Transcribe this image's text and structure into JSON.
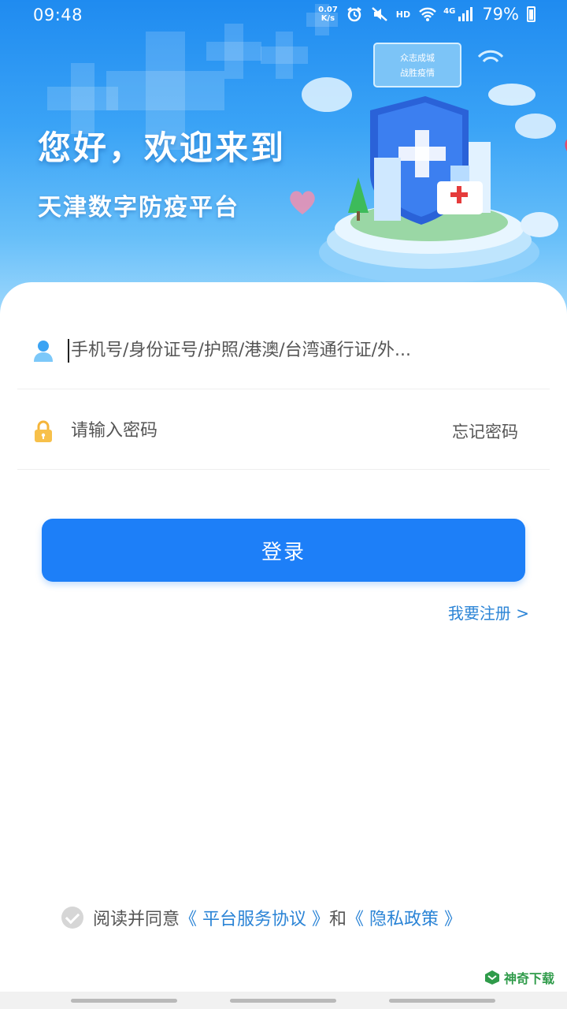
{
  "status_bar": {
    "time": "09:48",
    "net_speed_value": "0.07",
    "net_speed_unit": "K/s",
    "network_type": "HD",
    "signal_type": "4G",
    "battery": "79%"
  },
  "hero": {
    "title": "您好，欢迎来到",
    "subtitle": "天津数字防疫平台",
    "sign_line1": "众志成城",
    "sign_line2": "战胜疫情"
  },
  "login": {
    "account_placeholder": "手机号/身份证号/护照/港澳/台湾通行证/外...",
    "password_placeholder": "请输入密码",
    "forgot_password": "忘记密码",
    "login_button": "登录",
    "register_link": "我要注册 >"
  },
  "agreement": {
    "prefix": "阅读并同意",
    "service_link": "《 平台服务协议 》",
    "conjunction": "和",
    "privacy_link": "《 隐私政策 》"
  },
  "watermark": {
    "label": "神奇下载"
  },
  "colors": {
    "primary": "#1d7ff8",
    "link": "#2b84d6",
    "hero_top": "#1f8bf0",
    "hero_bottom": "#9fd8fc"
  }
}
